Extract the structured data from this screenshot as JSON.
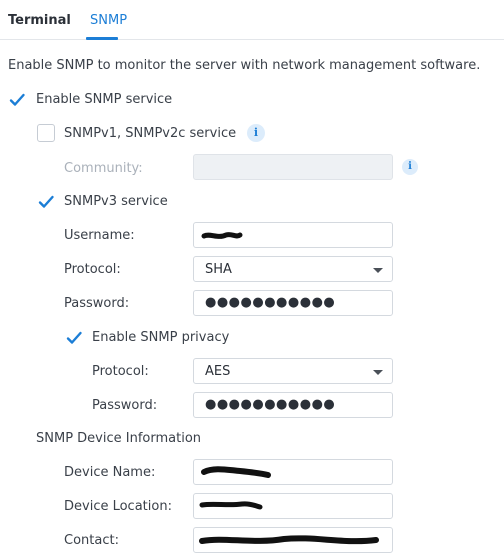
{
  "tabs": {
    "terminal": "Terminal",
    "snmp": "SNMP"
  },
  "description": "Enable SNMP to monitor the server with network management software.",
  "enable_snmp": {
    "label": "Enable SNMP service",
    "checked": true
  },
  "snmp_v1v2": {
    "label": "SNMPv1, SNMPv2c service",
    "checked": false,
    "info_icon": "i"
  },
  "community": {
    "label": "Community:",
    "value": "",
    "info_icon": "i"
  },
  "snmp_v3": {
    "label": "SNMPv3 service",
    "checked": true
  },
  "username": {
    "label": "Username:",
    "value": ""
  },
  "protocol": {
    "label": "Protocol:",
    "value": "SHA"
  },
  "password": {
    "label": "Password:",
    "value": "●●●●●●●●●●●"
  },
  "privacy": {
    "label": "Enable SNMP privacy",
    "checked": true
  },
  "privacy_protocol": {
    "label": "Protocol:",
    "value": "AES"
  },
  "privacy_password": {
    "label": "Password:",
    "value": "●●●●●●●●●●●"
  },
  "device_info": {
    "title": "SNMP Device Information",
    "device_name": {
      "label": "Device Name:",
      "value": ""
    },
    "device_location": {
      "label": "Device Location:",
      "value": ""
    },
    "contact": {
      "label": "Contact:",
      "value": ""
    }
  },
  "colors": {
    "accent": "#1c7ed6",
    "text": "#3a4049"
  }
}
